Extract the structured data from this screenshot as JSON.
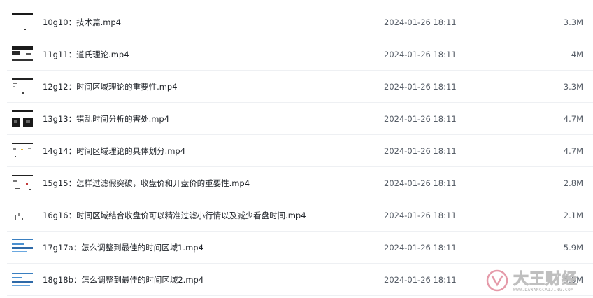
{
  "files": [
    {
      "name": "10g10：技术篇.mp4",
      "date": "2024-01-26 18:11",
      "size": "3.3M"
    },
    {
      "name": "11g11：道氏理论.mp4",
      "date": "2024-01-26 18:11",
      "size": "4M"
    },
    {
      "name": "12g12：时间区域理论的重要性.mp4",
      "date": "2024-01-26 18:11",
      "size": "3.3M"
    },
    {
      "name": "13g13：错乱时间分析的害处.mp4",
      "date": "2024-01-26 18:11",
      "size": "4.7M"
    },
    {
      "name": "14g14：时间区域理论的具体划分.mp4",
      "date": "2024-01-26 18:11",
      "size": "4.7M"
    },
    {
      "name": "15g15：怎样过滤假突破，收盘价和开盘价的重要性.mp4",
      "date": "2024-01-26 18:11",
      "size": "2.8M"
    },
    {
      "name": "16g16：时间区域结合收盘价可以精准过滤小行情以及减少看盘时间.mp4",
      "date": "2024-01-26 18:11",
      "size": "2.1M"
    },
    {
      "name": "17g17a：怎么调整到最佳的时间区域1.mp4",
      "date": "2024-01-26 18:11",
      "size": "5.9M"
    },
    {
      "name": "18g18b：怎么调整到最佳的时间区域2.mp4",
      "date": "2024-01-26 18:11",
      "size": "5.9M"
    }
  ],
  "watermark": {
    "text": "大王财经",
    "subtext": "WWW.DAWANGCAIJING.COM",
    "logo": "dw-logo-icon"
  }
}
